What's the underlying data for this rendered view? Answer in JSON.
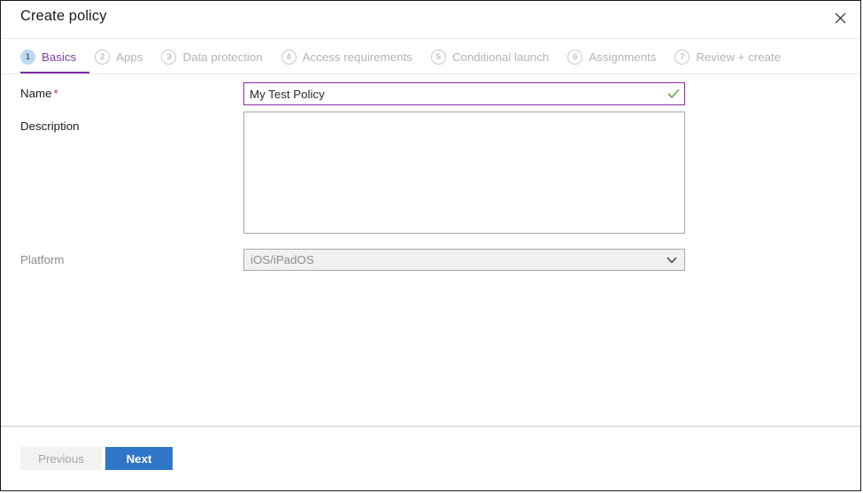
{
  "window": {
    "title": "Create policy",
    "close_icon": "close-icon"
  },
  "tabs": [
    {
      "num": "1",
      "label": "Basics",
      "active": true
    },
    {
      "num": "2",
      "label": "Apps",
      "active": false
    },
    {
      "num": "3",
      "label": "Data protection",
      "active": false
    },
    {
      "num": "4",
      "label": "Access requirements",
      "active": false
    },
    {
      "num": "5",
      "label": "Conditional launch",
      "active": false
    },
    {
      "num": "6",
      "label": "Assignments",
      "active": false
    },
    {
      "num": "7",
      "label": "Review + create",
      "active": false
    }
  ],
  "form": {
    "name": {
      "label": "Name",
      "required_marker": "*",
      "value": "My Test Policy",
      "placeholder": "",
      "validation_icon": "checkmark-icon"
    },
    "description": {
      "label": "Description",
      "value": "",
      "placeholder": ""
    },
    "platform": {
      "label": "Platform",
      "value": "iOS/iPadOS",
      "chevron_icon": "chevron-down-icon",
      "options": [
        "iOS/iPadOS"
      ]
    }
  },
  "footer": {
    "previous_label": "Previous",
    "next_label": "Next"
  },
  "colors": {
    "accent_purple": "#7a2da6",
    "primary_blue": "#2f76c8",
    "required_red": "#d13438",
    "valid_green": "#6aa84f",
    "active_tab_circle": "#bcd9f2"
  }
}
